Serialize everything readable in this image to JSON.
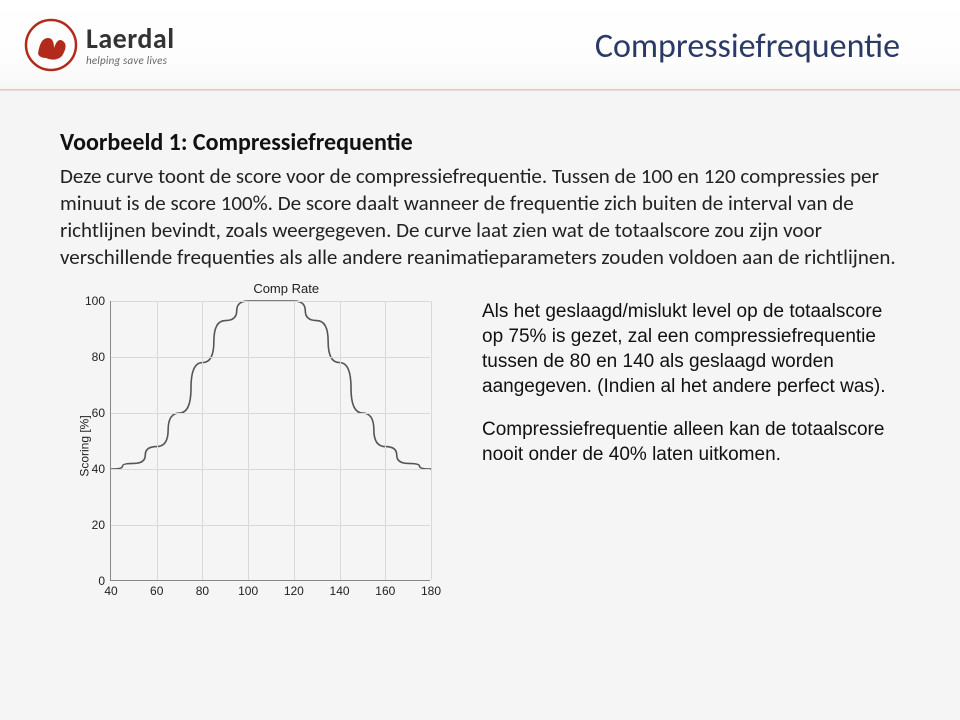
{
  "logo": {
    "word": "Laerdal",
    "tagline": "helping save lives"
  },
  "page_title": "Compressiefrequentie",
  "subtitle": "Voorbeeld 1: Compressiefrequentie",
  "paragraph": "Deze curve toont de score voor de compressiefrequentie. Tussen de 100 en 120 compressies per minuut is de score 100%. De score daalt wanneer de frequentie zich buiten de interval van de richtlijnen bevindt, zoals weergegeven. De curve laat zien wat de totaalscore zou zijn voor verschillende frequenties als alle andere reanimatieparameters zouden voldoen aan de richtlijnen.",
  "side": {
    "p1": "Als het geslaagd/mislukt level op de totaalscore op 75% is gezet, zal een compressiefrequentie tussen de  80 en 140 als geslaagd worden aangegeven. (Indien al het andere perfect was).",
    "p2": "Compressiefrequentie alleen kan de totaalscore nooit onder de 40% laten uitkomen."
  },
  "chart_data": {
    "type": "line",
    "title": "Comp Rate",
    "xlabel": "",
    "ylabel": "Scoring [%]",
    "xlim": [
      40,
      180
    ],
    "ylim": [
      0,
      100
    ],
    "x_ticks": [
      40,
      60,
      80,
      100,
      120,
      140,
      160,
      180
    ],
    "y_ticks": [
      0,
      20,
      40,
      60,
      80,
      100
    ],
    "x": [
      40,
      50,
      60,
      70,
      80,
      90,
      100,
      110,
      120,
      130,
      140,
      150,
      160,
      170,
      180
    ],
    "values": [
      40,
      42,
      48,
      60,
      78,
      93,
      100,
      100,
      100,
      93,
      78,
      60,
      48,
      42,
      40
    ]
  }
}
